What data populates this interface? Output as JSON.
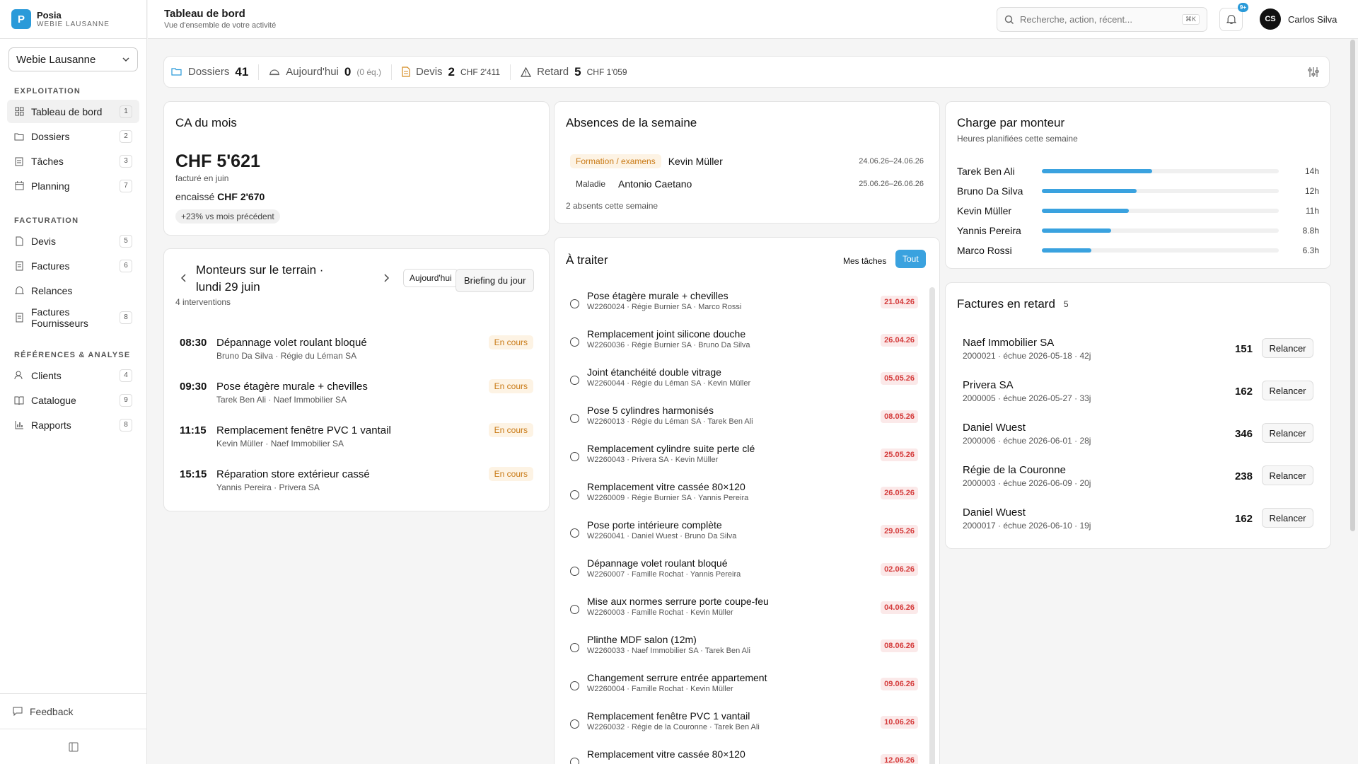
{
  "brand": {
    "name": "Posia",
    "sub": "WEBIE LAUSANNE",
    "logo_letter": "P"
  },
  "company_select": "Webie Lausanne",
  "sidebar": {
    "sections": [
      {
        "title": "EXPLOITATION",
        "items": [
          {
            "label": "Tableau de bord",
            "badge": "1",
            "icon": "dashboard-icon"
          },
          {
            "label": "Dossiers",
            "badge": "2",
            "icon": "folder-icon"
          },
          {
            "label": "Tâches",
            "badge": "3",
            "icon": "tasks-icon"
          },
          {
            "label": "Planning",
            "badge": "7",
            "icon": "calendar-icon"
          }
        ]
      },
      {
        "title": "FACTURATION",
        "items": [
          {
            "label": "Devis",
            "badge": "5",
            "icon": "document-icon"
          },
          {
            "label": "Factures",
            "badge": "6",
            "icon": "invoice-icon"
          },
          {
            "label": "Relances",
            "badge": "",
            "icon": "bell-icon"
          },
          {
            "label": "Factures Fournisseurs",
            "badge": "8",
            "icon": "receipt-icon"
          }
        ]
      },
      {
        "title": "RÉFÉRENCES & ANALYSE",
        "items": [
          {
            "label": "Clients",
            "badge": "4",
            "icon": "users-icon"
          },
          {
            "label": "Catalogue",
            "badge": "9",
            "icon": "book-icon"
          },
          {
            "label": "Rapports",
            "badge": "8",
            "icon": "chart-icon"
          }
        ]
      }
    ],
    "feedback": "Feedback"
  },
  "header": {
    "title": "Tableau de bord",
    "subtitle": "Vue d'ensemble de votre activité",
    "search_placeholder": "Recherche, action, récent...",
    "search_kbd": "⌘K",
    "notif_badge": "9+",
    "user_initials": "CS",
    "user_name": "Carlos Silva"
  },
  "stats": {
    "dossiers": {
      "label": "Dossiers",
      "value": "41"
    },
    "today": {
      "label": "Aujourd'hui",
      "value": "0",
      "extra": "(0 éq.)"
    },
    "devis": {
      "label": "Devis",
      "value": "2",
      "extra": "CHF 2'411"
    },
    "retard": {
      "label": "Retard",
      "value": "5",
      "extra": "CHF 1'059"
    }
  },
  "ca": {
    "title": "CA du mois",
    "amount": "CHF 5'621",
    "sub": "facturé en juin",
    "encaisse_label": "encaissé",
    "encaisse_value": "CHF 2'670",
    "trend": "+23% vs mois précédent"
  },
  "absences": {
    "title": "Absences de la semaine",
    "rows": [
      {
        "tag": "Formation / examens",
        "name": "Kevin Müller",
        "date": "24.06.26–24.06.26"
      },
      {
        "tag": "Maladie",
        "name": "Antonio Caetano",
        "date": "25.06.26–26.06.26"
      }
    ],
    "footer": "2 absents cette semaine"
  },
  "charge": {
    "title": "Charge par monteur",
    "subtitle": "Heures planifiées cette semaine",
    "rows": [
      {
        "name": "Tarek Ben Ali",
        "label": "14h",
        "hours": 14
      },
      {
        "name": "Bruno Da Silva",
        "label": "12h",
        "hours": 12
      },
      {
        "name": "Kevin Müller",
        "label": "11h",
        "hours": 11
      },
      {
        "name": "Yannis Pereira",
        "label": "8.8h",
        "hours": 8.8
      },
      {
        "name": "Marco Rossi",
        "label": "6.3h",
        "hours": 6.3
      }
    ]
  },
  "monteurs": {
    "title": "Monteurs sur le terrain · lundi 29 juin",
    "today_button": "Aujourd'hui",
    "briefing_button": "Briefing du jour",
    "count": "4 interventions",
    "rows": [
      {
        "time": "08:30",
        "task": "Dépannage volet roulant bloqué",
        "meta": "Bruno Da Silva · Régie du Léman SA",
        "status": "En cours"
      },
      {
        "time": "09:30",
        "task": "Pose étagère murale + chevilles",
        "meta": "Tarek Ben Ali · Naef Immobilier SA",
        "status": "En cours"
      },
      {
        "time": "11:15",
        "task": "Remplacement fenêtre PVC 1 vantail",
        "meta": "Kevin Müller · Naef Immobilier SA",
        "status": "En cours"
      },
      {
        "time": "15:15",
        "task": "Réparation store extérieur cassé",
        "meta": "Yannis Pereira · Privera SA",
        "status": "En cours"
      }
    ]
  },
  "traiter": {
    "title": "À traiter",
    "tab_mine": "Mes tâches",
    "tab_all": "Tout",
    "rows": [
      {
        "title": "Pose étagère murale + chevilles",
        "meta": "W2260024 · Régie Burnier SA · Marco Rossi",
        "date": "21.04.26"
      },
      {
        "title": "Remplacement joint silicone douche",
        "meta": "W2260036 · Régie Burnier SA · Bruno Da Silva",
        "date": "26.04.26"
      },
      {
        "title": "Joint étanchéité double vitrage",
        "meta": "W2260044 · Régie du Léman SA · Kevin Müller",
        "date": "05.05.26"
      },
      {
        "title": "Pose 5 cylindres harmonisés",
        "meta": "W2260013 · Régie du Léman SA · Tarek Ben Ali",
        "date": "08.05.26"
      },
      {
        "title": "Remplacement cylindre suite perte clé",
        "meta": "W2260043 · Privera SA · Kevin Müller",
        "date": "25.05.26"
      },
      {
        "title": "Remplacement vitre cassée 80×120",
        "meta": "W2260009 · Régie Burnier SA · Yannis Pereira",
        "date": "26.05.26"
      },
      {
        "title": "Pose porte intérieure complète",
        "meta": "W2260041 · Daniel Wuest · Bruno Da Silva",
        "date": "29.05.26"
      },
      {
        "title": "Dépannage volet roulant bloqué",
        "meta": "W2260007 · Famille Rochat · Yannis Pereira",
        "date": "02.06.26"
      },
      {
        "title": "Mise aux normes serrure porte coupe-feu",
        "meta": "W2260003 · Famille Rochat · Kevin Müller",
        "date": "04.06.26"
      },
      {
        "title": "Plinthe MDF salon (12m)",
        "meta": "W2260033 · Naef Immobilier SA · Tarek Ben Ali",
        "date": "08.06.26"
      },
      {
        "title": "Changement serrure entrée appartement",
        "meta": "W2260004 · Famille Rochat · Kevin Müller",
        "date": "09.06.26"
      },
      {
        "title": "Remplacement fenêtre PVC 1 vantail",
        "meta": "W2260032 · Régie de la Couronne · Tarek Ben Ali",
        "date": "10.06.26"
      },
      {
        "title": "Remplacement vitre cassée 80×120",
        "meta": "",
        "date": "12.06.26"
      }
    ]
  },
  "retard": {
    "title": "Factures en retard",
    "count": "5",
    "button": "Relancer",
    "rows": [
      {
        "name": "Naef Immobilier SA",
        "meta": "2000021 · échue 2026-05-18 · 42j",
        "amount": "151"
      },
      {
        "name": "Privera SA",
        "meta": "2000005 · échue 2026-05-27 · 33j",
        "amount": "162"
      },
      {
        "name": "Daniel Wuest",
        "meta": "2000006 · échue 2026-06-01 · 28j",
        "amount": "346"
      },
      {
        "name": "Régie de la Couronne",
        "meta": "2000003 · échue 2026-06-09 · 20j",
        "amount": "238"
      },
      {
        "name": "Daniel Wuest",
        "meta": "2000017 · échue 2026-06-10 · 19j",
        "amount": "162"
      }
    ]
  },
  "colors": {
    "accent": "#2a9ad9",
    "bar": "#3aa2df",
    "warning_bg": "#fdf3e4",
    "warning_text": "#c97a16",
    "danger_bg": "#fbe9e9",
    "danger_text": "#d43a3a"
  }
}
